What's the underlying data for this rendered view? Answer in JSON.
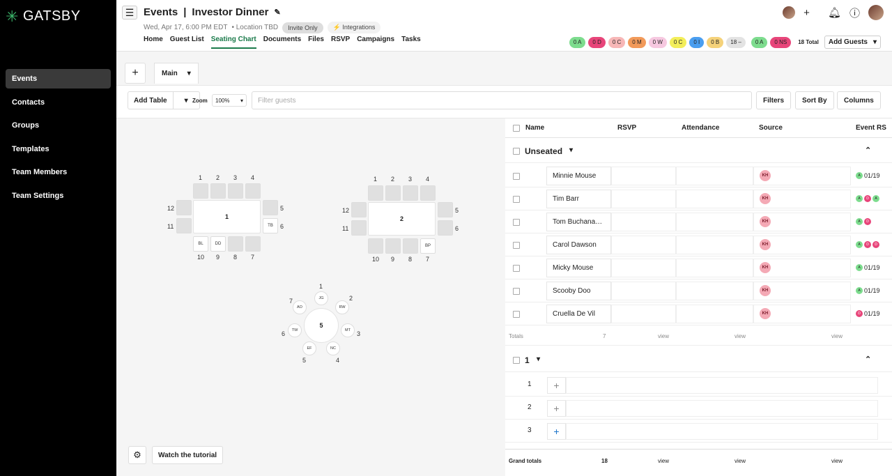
{
  "sidebar": {
    "logo": "GATSBY",
    "items": [
      {
        "label": "Events"
      },
      {
        "label": "Contacts"
      },
      {
        "label": "Groups"
      },
      {
        "label": "Templates"
      },
      {
        "label": "Team Members"
      },
      {
        "label": "Team Settings"
      }
    ]
  },
  "header": {
    "breadcrumb": "Events",
    "separator": "|",
    "event_name": "Investor Dinner",
    "date": "Wed, Apr 17, 6:00 PM EDT",
    "location": "• Location TBD",
    "invite_pill": "Invite Only",
    "integrations_pill": "⚡ Integrations",
    "tabs": [
      "Home",
      "Guest List",
      "Seating Chart",
      "Documents",
      "Files",
      "RSVP",
      "Campaigns",
      "Tasks"
    ],
    "badges": [
      {
        "text": "0 A",
        "bg": "#7ddc8e"
      },
      {
        "text": "0 D",
        "bg": "#e8457a"
      },
      {
        "text": "0 C",
        "bg": "#f7b7b7"
      },
      {
        "text": "0 M",
        "bg": "#f29a5a"
      },
      {
        "text": "0 W",
        "bg": "#f6c8e0"
      },
      {
        "text": "0 C",
        "bg": "#f3ee5a"
      },
      {
        "text": "0 I",
        "bg": "#4a9ef0"
      },
      {
        "text": "0 B",
        "bg": "#f5d27a"
      },
      {
        "text": "18 –",
        "bg": "#e3e3e3"
      },
      {
        "text": "0 A",
        "bg": "#7ddc8e"
      },
      {
        "text": "0 NS",
        "bg": "#e8457a"
      }
    ],
    "total": "18 Total",
    "add_guests": "Add Guests"
  },
  "toolbar": {
    "main_tab": "Main",
    "add_table": "Add Table",
    "zoom_label": "Zoom",
    "zoom_value": "100%",
    "filter_placeholder": "Filter guests",
    "filters": "Filters",
    "sort_by": "Sort By",
    "columns": "Columns"
  },
  "tables": [
    {
      "label": "1",
      "top_seats": [
        "1",
        "2",
        "3",
        "4"
      ],
      "right_seats": [
        "5",
        "6"
      ],
      "bottom_seats": [
        "10",
        "9",
        "8",
        "7"
      ],
      "left_seats": [
        "12",
        "11"
      ],
      "seat_initials": {
        "6": "TB",
        "10": "BL",
        "9": "DD"
      }
    },
    {
      "label": "2",
      "top_seats": [
        "1",
        "2",
        "3",
        "4"
      ],
      "right_seats": [
        "5",
        "6"
      ],
      "bottom_seats": [
        "10",
        "9",
        "8",
        "7"
      ],
      "left_seats": [
        "12",
        "11"
      ],
      "seat_initials": {
        "7": "BP"
      }
    },
    {
      "label": "5",
      "seats": [
        {
          "num": "1",
          "initials": "JG"
        },
        {
          "num": "2",
          "initials": "RW"
        },
        {
          "num": "3",
          "initials": "MT"
        },
        {
          "num": "4",
          "initials": "NC"
        },
        {
          "num": "5",
          "initials": "EF"
        },
        {
          "num": "6",
          "initials": "TW"
        },
        {
          "num": "7",
          "initials": "AO"
        }
      ]
    }
  ],
  "canvas_footer": {
    "tutorial": "Watch the tutorial"
  },
  "grid": {
    "columns": [
      "Name",
      "RSVP",
      "Attendance",
      "Source",
      "Event RS"
    ],
    "unseated_label": "Unseated",
    "guests": [
      {
        "name": "Minnie Mouse",
        "source": "KH",
        "event_dots": [
          "A"
        ],
        "event_date": "01/19"
      },
      {
        "name": "Tim Barr",
        "source": "KH",
        "event_dots": [
          "A",
          "D",
          "A"
        ],
        "event_date": ""
      },
      {
        "name": "Tom Buchana…",
        "source": "KH",
        "event_dots": [
          "A",
          "D"
        ],
        "event_date": ""
      },
      {
        "name": "Carol Dawson",
        "source": "KH",
        "event_dots": [
          "A",
          "D",
          "D"
        ],
        "event_date": ""
      },
      {
        "name": "Micky Mouse",
        "source": "KH",
        "event_dots": [
          "A"
        ],
        "event_date": "01/19"
      },
      {
        "name": "Scooby Doo",
        "source": "KH",
        "event_dots": [
          "A"
        ],
        "event_date": "01/19"
      },
      {
        "name": "Cruella De Vil",
        "source": "KH",
        "event_dots": [
          "D"
        ],
        "event_date": "01/19"
      }
    ],
    "totals_label": "Totals",
    "totals_count": "7",
    "view": "view",
    "table_group_label": "1",
    "seat_rows": [
      "1",
      "2",
      "3"
    ],
    "grand_totals_label": "Grand totals",
    "grand_totals_count": "18"
  }
}
